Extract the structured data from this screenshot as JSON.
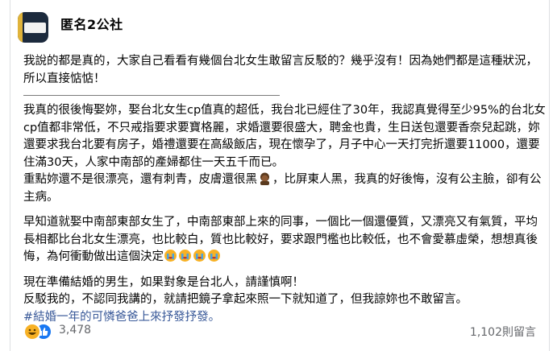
{
  "header": {
    "page_name": "匿名2公社"
  },
  "post": {
    "paragraphs": [
      "我說的都是真的，大家自己看看有幾個台北女生敢留言反駁的？幾乎沒有！因為她們都是這種狀況，所以直接惦惦！",
      "我真的很後悔娶妳，娶台北女生cp值真的超低，我台北已經住了30年，我認真覺得至少95%的台北女cp值都非常低，不只戒指要求要寶格麗，求婚還要很盛大，聘金也貴，生日送包還要香奈兒起跳，妳還要求我台北要有房子，婚禮還要在高級飯店，現在懷孕了，月子中心一天打完折還要11000，還要住滿30天，人家中南部的產婦都住一天五千而已。",
      "重點妳還不是很漂亮，還有刺青，皮膚還很黑",
      "，比屏東人黑，我真的好後悔，沒有公主臉，卻有公主病。",
      "早知道就娶中南部東部女生了，中南部東部上來的同事，一個比一個還優質，又漂亮又有氣質，平均長相都比台北女生漂亮，也比較白，質也比較好，要求跟門檻也比較低，也不會愛慕虛榮，想想真後悔，為何衝動做出這個決定",
      "現在準備結婚的男生，如果對象是台北人，請謹慎啊！",
      "反駁我的，不認同我講的，就請把鏡子拿起來照一下就知道了，但我諒妳也不敢留言。",
      "#結婚一年的可憐爸爸上來抒發抒發。"
    ]
  },
  "footer": {
    "reaction_count": "3,478",
    "comment_count": "1,102則留言"
  },
  "colors": {
    "text": "#050505",
    "secondary": "#65676b",
    "link": "#385898",
    "like_blue": "#1877f2",
    "haha_yellow": "#f7b125"
  }
}
